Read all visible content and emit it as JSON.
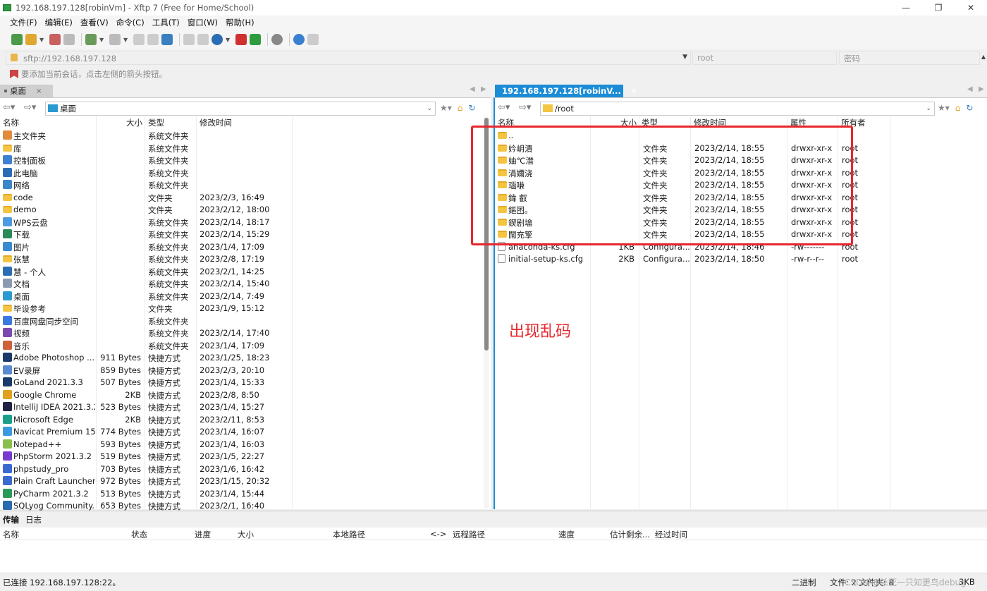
{
  "window": {
    "title": "192.168.197.128[robinVm] - Xftp 7 (Free for Home/School)"
  },
  "menu": [
    "文件(F)",
    "编辑(E)",
    "查看(V)",
    "命令(C)",
    "工具(T)",
    "窗口(W)",
    "帮助(H)"
  ],
  "address": {
    "url": "sftp://192.168.197.128",
    "user_placeholder": "root",
    "pass_placeholder": "密码"
  },
  "hint": "要添加当前会话，点击左侧的箭头按钮。",
  "left_tab": "桌面",
  "right_tab": "192.168.197.128[robinV...",
  "left": {
    "path": "桌面",
    "columns": {
      "name": "名称",
      "size": "大小",
      "type": "类型",
      "mtime": "修改时间"
    },
    "rows": [
      {
        "name": "主文件夹",
        "size": "",
        "type": "系统文件夹",
        "mtime": "",
        "icon": "home-icon",
        "color": "#e08a3a"
      },
      {
        "name": "库",
        "size": "",
        "type": "系统文件夹",
        "mtime": "",
        "icon": "folder-icon",
        "color": "#f4c542"
      },
      {
        "name": "控制面板",
        "size": "",
        "type": "系统文件夹",
        "mtime": "",
        "icon": "control-panel-icon",
        "color": "#3d7fd1"
      },
      {
        "name": "此电脑",
        "size": "",
        "type": "系统文件夹",
        "mtime": "",
        "icon": "computer-icon",
        "color": "#2a6db5"
      },
      {
        "name": "网络",
        "size": "",
        "type": "系统文件夹",
        "mtime": "",
        "icon": "network-icon",
        "color": "#3a86c8"
      },
      {
        "name": "code",
        "size": "",
        "type": "文件夹",
        "mtime": "2023/2/3, 16:49",
        "icon": "folder-icon",
        "color": "#f4c542"
      },
      {
        "name": "demo",
        "size": "",
        "type": "文件夹",
        "mtime": "2023/2/12, 18:00",
        "icon": "folder-icon",
        "color": "#f4c542"
      },
      {
        "name": "WPS云盘",
        "size": "",
        "type": "系统文件夹",
        "mtime": "2023/2/14, 18:17",
        "icon": "cloud-icon",
        "color": "#4a9be0"
      },
      {
        "name": "下载",
        "size": "",
        "type": "系统文件夹",
        "mtime": "2023/2/14, 15:29",
        "icon": "download-icon",
        "color": "#2a8a5a"
      },
      {
        "name": "图片",
        "size": "",
        "type": "系统文件夹",
        "mtime": "2023/1/4, 17:09",
        "icon": "pictures-icon",
        "color": "#3a8ad0"
      },
      {
        "name": "张慧",
        "size": "",
        "type": "系统文件夹",
        "mtime": "2023/2/8, 17:19",
        "icon": "folder-icon",
        "color": "#f4c542"
      },
      {
        "name": "慧 - 个人",
        "size": "",
        "type": "系统文件夹",
        "mtime": "2023/2/1, 14:25",
        "icon": "onedrive-icon",
        "color": "#2a6db5"
      },
      {
        "name": "文档",
        "size": "",
        "type": "系统文件夹",
        "mtime": "2023/2/14, 15:40",
        "icon": "documents-icon",
        "color": "#8a9ab0"
      },
      {
        "name": "桌面",
        "size": "",
        "type": "系统文件夹",
        "mtime": "2023/2/14, 7:49",
        "icon": "desktop-icon",
        "color": "#2a9ad0"
      },
      {
        "name": "毕设参考",
        "size": "",
        "type": "文件夹",
        "mtime": "2023/1/9, 15:12",
        "icon": "folder-icon",
        "color": "#f4c542"
      },
      {
        "name": "百度网盘同步空间",
        "size": "",
        "type": "系统文件夹",
        "mtime": "",
        "icon": "baidu-netdisk-icon",
        "color": "#3a7ae0"
      },
      {
        "name": "视频",
        "size": "",
        "type": "系统文件夹",
        "mtime": "2023/2/14, 17:40",
        "icon": "videos-icon",
        "color": "#7a4ab0"
      },
      {
        "name": "音乐",
        "size": "",
        "type": "系统文件夹",
        "mtime": "2023/1/4, 17:09",
        "icon": "music-icon",
        "color": "#d0603a"
      },
      {
        "name": "Adobe Photoshop ...",
        "size": "911 Bytes",
        "type": "快捷方式",
        "mtime": "2023/1/25, 18:23",
        "icon": "photoshop-icon",
        "color": "#1a3a6a"
      },
      {
        "name": "EV录屏",
        "size": "859 Bytes",
        "type": "快捷方式",
        "mtime": "2023/2/3, 20:10",
        "icon": "ev-recorder-icon",
        "color": "#5a8ad0"
      },
      {
        "name": "GoLand 2021.3.3",
        "size": "507 Bytes",
        "type": "快捷方式",
        "mtime": "2023/1/4, 15:33",
        "icon": "goland-icon",
        "color": "#1a3a6a"
      },
      {
        "name": "Google Chrome",
        "size": "2KB",
        "type": "快捷方式",
        "mtime": "2023/2/8, 8:50",
        "icon": "chrome-icon",
        "color": "#e0a020"
      },
      {
        "name": "IntelliJ IDEA 2021.3.2",
        "size": "523 Bytes",
        "type": "快捷方式",
        "mtime": "2023/1/4, 15:27",
        "icon": "intellij-icon",
        "color": "#222244"
      },
      {
        "name": "Microsoft Edge",
        "size": "2KB",
        "type": "快捷方式",
        "mtime": "2023/2/11, 8:53",
        "icon": "edge-icon",
        "color": "#1aa08a"
      },
      {
        "name": "Navicat Premium 15",
        "size": "774 Bytes",
        "type": "快捷方式",
        "mtime": "2023/1/4, 16:07",
        "icon": "navicat-icon",
        "color": "#3a9ae0"
      },
      {
        "name": "Notepad++",
        "size": "593 Bytes",
        "type": "快捷方式",
        "mtime": "2023/1/4, 16:03",
        "icon": "notepadpp-icon",
        "color": "#8ac04a"
      },
      {
        "name": "PhpStorm 2021.3.2",
        "size": "519 Bytes",
        "type": "快捷方式",
        "mtime": "2023/1/5, 22:27",
        "icon": "phpstorm-icon",
        "color": "#7a3ad0"
      },
      {
        "name": "phpstudy_pro",
        "size": "703 Bytes",
        "type": "快捷方式",
        "mtime": "2023/1/6, 16:42",
        "icon": "phpstudy-icon",
        "color": "#3a6ad0"
      },
      {
        "name": "Plain Craft Launcher...",
        "size": "972 Bytes",
        "type": "快捷方式",
        "mtime": "2023/1/15, 20:32",
        "icon": "launcher-icon",
        "color": "#3a6ad0"
      },
      {
        "name": "PyCharm 2021.3.2",
        "size": "513 Bytes",
        "type": "快捷方式",
        "mtime": "2023/1/4, 15:44",
        "icon": "pycharm-icon",
        "color": "#2a9a5a"
      },
      {
        "name": "SQLyog Community...",
        "size": "653 Bytes",
        "type": "快捷方式",
        "mtime": "2023/2/1, 16:40",
        "icon": "sqlyog-icon",
        "color": "#2a6ab0"
      }
    ]
  },
  "right": {
    "path": "/root",
    "columns": {
      "name": "名称",
      "size": "大小",
      "type": "类型",
      "mtime": "修改时间",
      "perm": "属性",
      "owner": "所有者"
    },
    "rows": [
      {
        "name": "..",
        "size": "",
        "type": "",
        "mtime": "",
        "perm": "",
        "owner": "",
        "kind": "folder"
      },
      {
        "name": "妗岄潰",
        "size": "",
        "type": "文件夹",
        "mtime": "2023/2/14, 18:55",
        "perm": "drwxr-xr-x",
        "owner": "root",
        "kind": "folder"
      },
      {
        "name": "妯℃澘",
        "size": "",
        "type": "文件夹",
        "mtime": "2023/2/14, 18:55",
        "perm": "drwxr-xr-x",
        "owner": "root",
        "kind": "folder"
      },
      {
        "name": "涓嬭浇",
        "size": "",
        "type": "文件夹",
        "mtime": "2023/2/14, 18:55",
        "perm": "drwxr-xr-x",
        "owner": "root",
        "kind": "folder"
      },
      {
        "name": "瑙嗛",
        "size": "",
        "type": "文件夹",
        "mtime": "2023/2/14, 18:55",
        "perm": "drwxr-xr-x",
        "owner": "root",
        "kind": "folder"
      },
      {
        "name": "鍏 叡",
        "size": "",
        "type": "文件夹",
        "mtime": "2023/2/14, 18:55",
        "perm": "drwxr-xr-x",
        "owner": "root",
        "kind": "folder"
      },
      {
        "name": "鏂囨。",
        "size": "",
        "type": "文件夹",
        "mtime": "2023/2/14, 18:55",
        "perm": "drwxr-xr-x",
        "owner": "root",
        "kind": "folder"
      },
      {
        "name": "鍥剧墖",
        "size": "",
        "type": "文件夹",
        "mtime": "2023/2/14, 18:55",
        "perm": "drwxr-xr-x",
        "owner": "root",
        "kind": "folder"
      },
      {
        "name": "闊充箰",
        "size": "",
        "type": "文件夹",
        "mtime": "2023/2/14, 18:55",
        "perm": "drwxr-xr-x",
        "owner": "root",
        "kind": "folder"
      },
      {
        "name": "anaconda-ks.cfg",
        "size": "1KB",
        "type": "Configura...",
        "mtime": "2023/2/14, 18:46",
        "perm": "-rw-------",
        "owner": "root",
        "kind": "file"
      },
      {
        "name": "initial-setup-ks.cfg",
        "size": "2KB",
        "type": "Configura...",
        "mtime": "2023/2/14, 18:50",
        "perm": "-rw-r--r--",
        "owner": "root",
        "kind": "file"
      }
    ]
  },
  "annotation": "出现乱码",
  "transfer": {
    "tabs": [
      "传输",
      "日志"
    ],
    "columns": [
      "名称",
      "状态",
      "进度",
      "大小",
      "本地路径",
      "<->",
      "远程路径",
      "速度",
      "估计剩余...",
      "经过时间"
    ]
  },
  "status": {
    "connection": "已连接 192.168.197.128:22。",
    "mode": "二进制",
    "files": "文件: 2 文件夹: 8",
    "size": "3KB",
    "watermark": "CSDN @杀死一只知更鸟debug"
  }
}
